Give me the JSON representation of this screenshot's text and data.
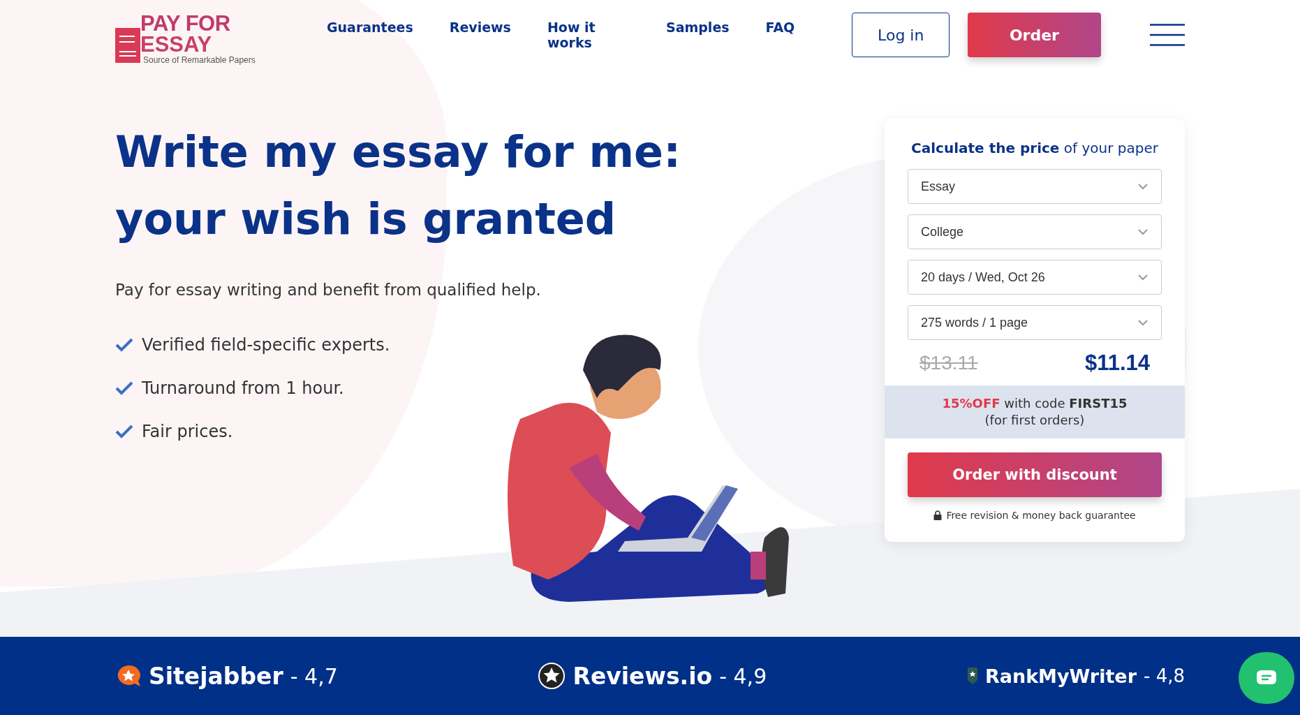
{
  "logo": {
    "line1": "PAY FOR",
    "line2": "ESSAY",
    "tagline": "Source of Remarkable Papers"
  },
  "nav": [
    "Guarantees",
    "Reviews",
    "How it works",
    "Samples",
    "FAQ"
  ],
  "login": "Log in",
  "order": "Order",
  "hero": {
    "title_line1": "Write my essay for me:",
    "title_line2": "your wish is granted",
    "subtitle": "Pay for essay writing and benefit from qualified help.",
    "features": [
      "Verified field-specific experts.",
      "Turnaround from 1 hour.",
      "Fair prices."
    ]
  },
  "calculator": {
    "heading": "**Calculate the price** of your paper",
    "selects": [
      "Essay",
      "College",
      "20 days / Wed, Oct 26",
      "275 words / 1 page"
    ],
    "old_price": "$13.11",
    "price": "$11.14",
    "promo": {
      "discount": "15%OFF",
      "text": "with code",
      "code": "FIRST15",
      "note": "(for first orders)"
    },
    "button": "Order with discount",
    "guarantee": "Free revision & money back guarantee"
  },
  "ratings": [
    {
      "kind": "bubble",
      "name": "Sitejabber",
      "score": "- 4,7"
    },
    {
      "kind": "circle",
      "name": "Reviews.io",
      "score": "- 4,9"
    },
    {
      "kind": "shield",
      "name": "RankMyWriter",
      "score": "- 4,8"
    }
  ]
}
